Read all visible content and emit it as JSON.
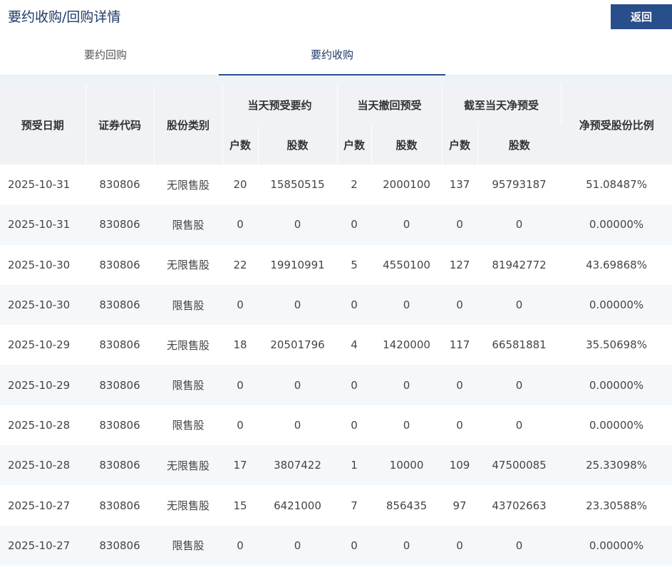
{
  "header": {
    "title": "要约收购/回购详情",
    "back_label": "返回"
  },
  "tabs": [
    {
      "label": "要约回购",
      "active": false
    },
    {
      "label": "要约收购",
      "active": true
    }
  ],
  "table": {
    "col_date": "预受日期",
    "col_code": "证券代码",
    "col_type": "股份类别",
    "group_day": "当天预受要约",
    "group_withdraw": "当天撤回预受",
    "group_net": "截至当天净预受",
    "col_ratio": "净预受股份比例",
    "sub_households": "户数",
    "sub_shares": "股数",
    "rows": [
      [
        "2025-10-31",
        "830806",
        "无限售股",
        "20",
        "15850515",
        "2",
        "2000100",
        "137",
        "95793187",
        "51.08487%"
      ],
      [
        "2025-10-31",
        "830806",
        "限售股",
        "0",
        "0",
        "0",
        "0",
        "0",
        "0",
        "0.00000%"
      ],
      [
        "2025-10-30",
        "830806",
        "无限售股",
        "22",
        "19910991",
        "5",
        "4550100",
        "127",
        "81942772",
        "43.69868%"
      ],
      [
        "2025-10-30",
        "830806",
        "限售股",
        "0",
        "0",
        "0",
        "0",
        "0",
        "0",
        "0.00000%"
      ],
      [
        "2025-10-29",
        "830806",
        "无限售股",
        "18",
        "20501796",
        "4",
        "1420000",
        "117",
        "66581881",
        "35.50698%"
      ],
      [
        "2025-10-29",
        "830806",
        "限售股",
        "0",
        "0",
        "0",
        "0",
        "0",
        "0",
        "0.00000%"
      ],
      [
        "2025-10-28",
        "830806",
        "限售股",
        "0",
        "0",
        "0",
        "0",
        "0",
        "0",
        "0.00000%"
      ],
      [
        "2025-10-28",
        "830806",
        "无限售股",
        "17",
        "3807422",
        "1",
        "10000",
        "109",
        "47500085",
        "25.33098%"
      ],
      [
        "2025-10-27",
        "830806",
        "无限售股",
        "15",
        "6421000",
        "7",
        "856435",
        "97",
        "43702663",
        "23.30588%"
      ],
      [
        "2025-10-27",
        "830806",
        "限售股",
        "0",
        "0",
        "0",
        "0",
        "0",
        "0",
        "0.00000%"
      ]
    ]
  }
}
